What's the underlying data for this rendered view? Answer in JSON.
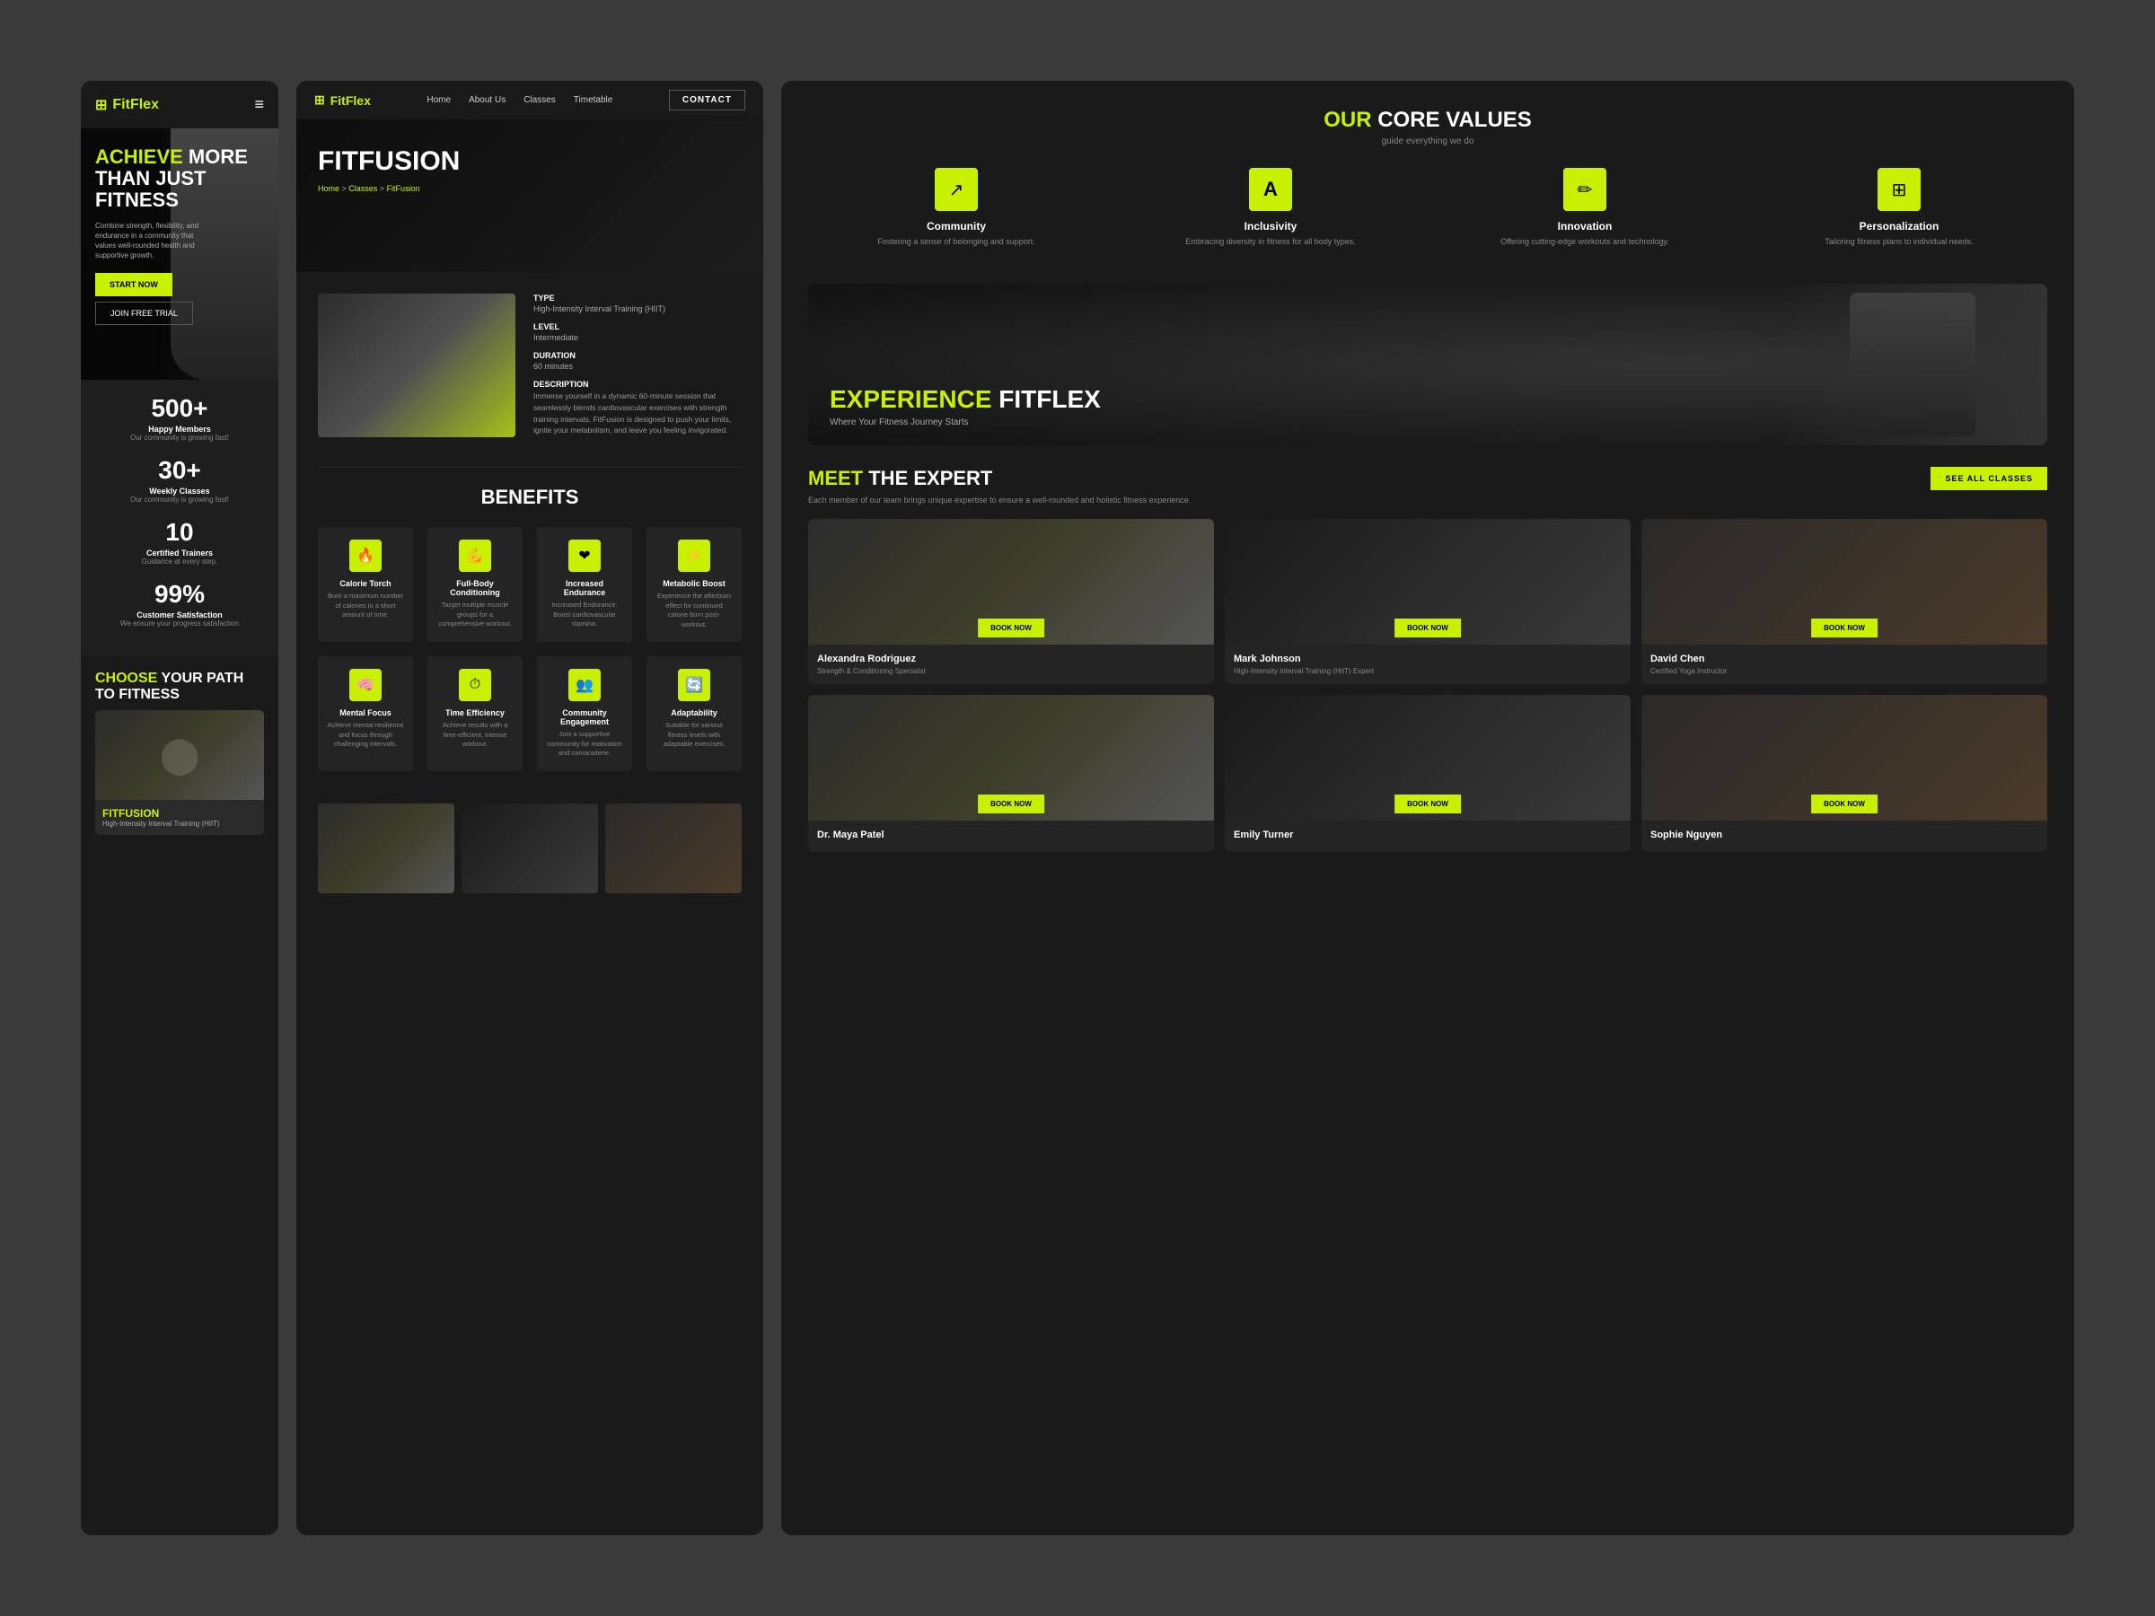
{
  "app": {
    "name": "FitFlex",
    "logo_symbol": "⊞"
  },
  "mobile": {
    "hero": {
      "title_highlight": "ACHIEVE",
      "title_rest": " MORE THAN JUST FITNESS",
      "subtitle": "Combine strength, flexibility, and endurance in a community that values well-rounded health and supportive growth.",
      "cta_primary": "START NOW",
      "cta_secondary": "JOIN FREE TRIAL"
    },
    "stats": [
      {
        "number": "500+",
        "label": "Happy Members",
        "sub": "Our community is growing fast!"
      },
      {
        "number": "30+",
        "label": "Weekly Classes",
        "sub": "Our community is growing fast!"
      },
      {
        "number": "10",
        "label": "Certified Trainers",
        "sub": "Guidance at every step."
      },
      {
        "number": "99%",
        "label": "Customer Satisfaction",
        "sub": "We ensure your progress satisfaction"
      }
    ],
    "choose_section": {
      "title_highlight": "CHOOSE",
      "title_rest": " YOUR PATH TO FITNESS"
    },
    "class_card": {
      "name": "FITFUSION",
      "type": "High-Intensity Interval Training (HIIT)"
    }
  },
  "class_detail": {
    "nav": {
      "logo": "FitFlex",
      "links": [
        "Home",
        "About Us",
        "Classes",
        "Timetable"
      ],
      "contact_btn": "CONTACT"
    },
    "hero": {
      "title": "FITFUSION",
      "breadcrumb_home": "Home",
      "breadcrumb_classes": "Classes",
      "breadcrumb_current": "FitFusion"
    },
    "info": {
      "type_label": "Type",
      "type_value": "High-Intensity Interval Training (HIIT)",
      "level_label": "Level",
      "level_value": "Intermediate",
      "duration_label": "Duration",
      "duration_value": "60 minutes",
      "description_label": "Description",
      "description_value": "Immerse yourself in a dynamic 60-minute session that seamlessly blends cardiovascular exercises with strength training intervals. FitFusion is designed to push your limits, ignite your metabolism, and leave you feeling invigorated."
    },
    "benefits_section": {
      "title": "BENEFITS",
      "items": [
        {
          "icon": "🔥",
          "name": "Calorie Torch",
          "desc": "Burn a maximum number of calories in a short amount of time."
        },
        {
          "icon": "💪",
          "name": "Full-Body Conditioning",
          "desc": "Target multiple muscle groups for a comprehensive workout."
        },
        {
          "icon": "❤",
          "name": "Increased Endurance",
          "desc": "Increased Endurance: Boost cardiovascular stamina."
        },
        {
          "icon": "⚡",
          "name": "Metabolic Boost",
          "desc": "Experience the afterburn effect for continued calorie burn post-workout."
        },
        {
          "icon": "🧠",
          "name": "Mental Focus",
          "desc": "Achieve mental resilience and focus through challenging intervals."
        },
        {
          "icon": "⏱",
          "name": "Time Efficiency",
          "desc": "Achieve results with a time-efficient, intense workout."
        },
        {
          "icon": "👥",
          "name": "Community Engagement",
          "desc": "Join a supportive community for motivation and camaraderie."
        },
        {
          "icon": "🔄",
          "name": "Adaptability",
          "desc": "Suitable for various fitness levels with adaptable exercises."
        }
      ]
    }
  },
  "right_panel": {
    "core_values": {
      "title_highlight": "OUR",
      "title_rest": " CORE VALUES",
      "subtitle": "guide everything we do",
      "values": [
        {
          "icon": "↗",
          "name": "Community",
          "desc": "Fostering a sense of belonging and support."
        },
        {
          "icon": "A",
          "name": "Inclusivity",
          "desc": "Embracing diversity in fitness for all body types."
        },
        {
          "icon": "✏",
          "name": "Innovation",
          "desc": "Offering cutting-edge workouts and technology."
        },
        {
          "icon": "⊞",
          "name": "Personalization",
          "desc": "Tailoring fitness plans to individual needs."
        }
      ]
    },
    "experience": {
      "title_highlight": "EXPERIENCE",
      "title_rest": " FITFLEX",
      "subtitle": "Where Your Fitness Journey Starts"
    },
    "experts": {
      "title_highlight": "MEET",
      "title_rest": " THE EXPERT",
      "subtitle": "Each member of our team brings unique expertise to ensure a well-rounded and holistic fitness experience.",
      "see_all_btn": "SEE ALL CLASSES",
      "trainers": [
        {
          "name": "Alexandra Rodriguez",
          "role": "Strength & Conditioning Specialist",
          "book_btn": "BOOK NOW"
        },
        {
          "name": "Mark Johnson",
          "role": "High-Intensity Interval Training (HIIT) Expert",
          "book_btn": "BOOK NOW"
        },
        {
          "name": "David Chen",
          "role": "Certified Yoga Instructor",
          "book_btn": "BOOK NOW"
        },
        {
          "name": "Dr. Maya Patel",
          "role": "",
          "book_btn": "BOOK NOW"
        },
        {
          "name": "Emily Turner",
          "role": "",
          "book_btn": "BOOK NOW"
        },
        {
          "name": "Sophie Nguyen",
          "role": "",
          "book_btn": "BOOK NOW"
        }
      ]
    }
  }
}
